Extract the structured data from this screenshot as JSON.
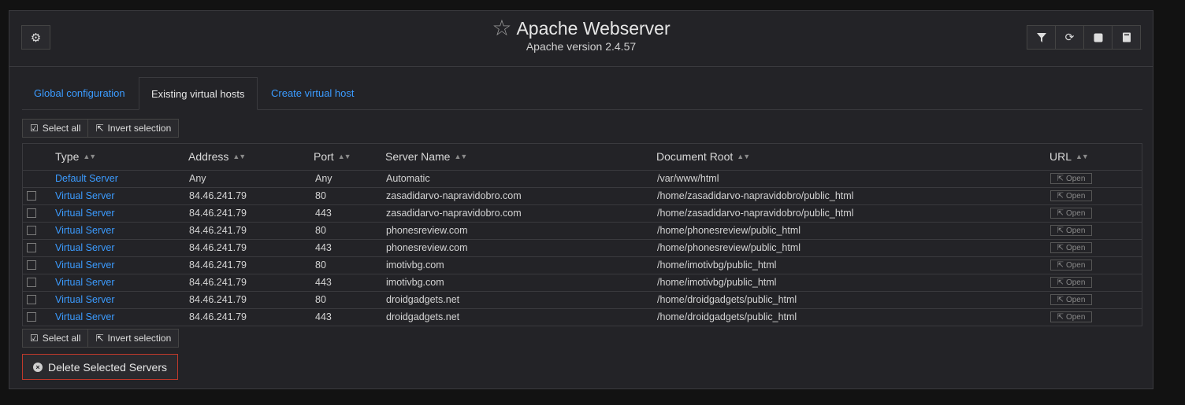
{
  "header": {
    "title": "Apache Webserver",
    "subtitle": "Apache version 2.4.57",
    "icons": {
      "settings": "gear-icon",
      "star": "star-icon",
      "toolbar": [
        "filter-icon",
        "refresh-icon",
        "square-icon",
        "book-icon"
      ]
    }
  },
  "tabs": [
    {
      "label": "Global configuration"
    },
    {
      "label": "Existing virtual hosts"
    },
    {
      "label": "Create virtual host"
    }
  ],
  "selection": {
    "select_all": "Select all",
    "invert": "Invert selection"
  },
  "table": {
    "columns": [
      "Type",
      "Address",
      "Port",
      "Server Name",
      "Document Root",
      "URL"
    ],
    "open_label": "Open",
    "rows": [
      {
        "type": "Default Server",
        "address": "Any",
        "port": "Any",
        "server_name": "Automatic",
        "doc_root": "/var/www/html"
      },
      {
        "type": "Virtual Server",
        "address": "84.46.241.79",
        "port": "80",
        "server_name": "zasadidarvo-napravidobro.com",
        "doc_root": "/home/zasadidarvo-napravidobro/public_html"
      },
      {
        "type": "Virtual Server",
        "address": "84.46.241.79",
        "port": "443",
        "server_name": "zasadidarvo-napravidobro.com",
        "doc_root": "/home/zasadidarvo-napravidobro/public_html"
      },
      {
        "type": "Virtual Server",
        "address": "84.46.241.79",
        "port": "80",
        "server_name": "phonesreview.com",
        "doc_root": "/home/phonesreview/public_html"
      },
      {
        "type": "Virtual Server",
        "address": "84.46.241.79",
        "port": "443",
        "server_name": "phonesreview.com",
        "doc_root": "/home/phonesreview/public_html"
      },
      {
        "type": "Virtual Server",
        "address": "84.46.241.79",
        "port": "80",
        "server_name": "imotivbg.com",
        "doc_root": "/home/imotivbg/public_html"
      },
      {
        "type": "Virtual Server",
        "address": "84.46.241.79",
        "port": "443",
        "server_name": "imotivbg.com",
        "doc_root": "/home/imotivbg/public_html"
      },
      {
        "type": "Virtual Server",
        "address": "84.46.241.79",
        "port": "80",
        "server_name": "droidgadgets.net",
        "doc_root": "/home/droidgadgets/public_html"
      },
      {
        "type": "Virtual Server",
        "address": "84.46.241.79",
        "port": "443",
        "server_name": "droidgadgets.net",
        "doc_root": "/home/droidgadgets/public_html"
      }
    ]
  },
  "delete_label": "Delete Selected Servers",
  "colors": {
    "link": "#3b9bff",
    "danger": "#c0392b",
    "panel": "#232327"
  }
}
